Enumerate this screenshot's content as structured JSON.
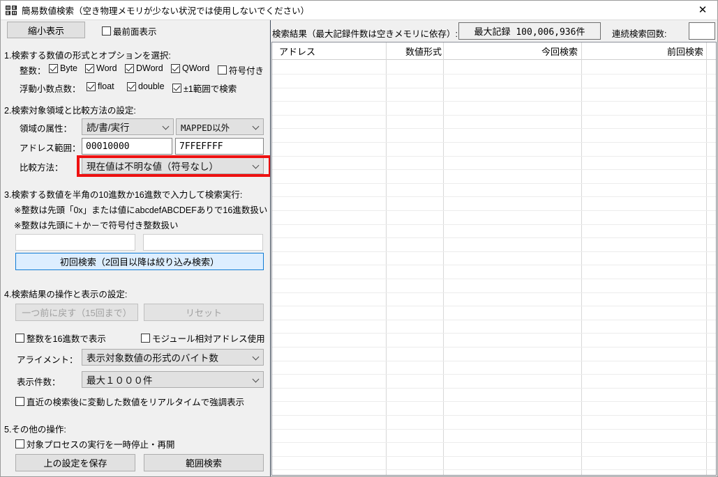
{
  "window": {
    "title": "簡易数値検索（空き物理メモリが少ない状況では使用しないでください）",
    "icon": "app-grid-icon",
    "close_label": "✕"
  },
  "toolbar": {
    "shrink_button": "縮小表示",
    "topmost_checkbox": {
      "label": "最前面表示",
      "checked": false
    }
  },
  "section1": {
    "title": "1.検索する数値の形式とオプションを選択:",
    "integer_label": "整数：",
    "integer_options": [
      {
        "label": "Byte",
        "checked": true
      },
      {
        "label": "Word",
        "checked": true
      },
      {
        "label": "DWord",
        "checked": true
      },
      {
        "label": "QWord",
        "checked": true
      },
      {
        "label": "符号付き",
        "checked": false
      }
    ],
    "float_label": "浮動小数点数：",
    "float_options": [
      {
        "label": "float",
        "checked": true
      },
      {
        "label": "double",
        "checked": true
      },
      {
        "label": "±1範囲で検索",
        "checked": true
      }
    ]
  },
  "section2": {
    "title": "2.検索対象領域と比較方法の設定:",
    "attr_label": "領域の属性：",
    "attr_select1": "読/書/実行",
    "attr_select2": "MAPPED以外",
    "range_label": "アドレス範囲：",
    "range_start": "00010000",
    "range_end": "7FFEFFFF",
    "compare_label": "比較方法：",
    "compare_select": "現在値は不明な値（符号なし）",
    "highlight_color": "#ee1111"
  },
  "section3": {
    "title": "3.検索する数値を半角の10進数か16進数で入力して検索実行:",
    "note1": "※整数は先頭「0x」または値にabcdefABCDEFありで16進数扱い",
    "note2": "※整数は先頭に＋か－で符号付き整数扱い",
    "value_input1": "",
    "value_input2": "",
    "search_button": "初回検索（2回目以降は絞り込み検索）"
  },
  "section4": {
    "title": "4.検索結果の操作と表示の設定:",
    "undo_button": {
      "label": "一つ前に戻す（15回まで）",
      "disabled": true
    },
    "reset_button": {
      "label": "リセット",
      "disabled": true
    },
    "hex_checkbox": {
      "label": "整数を16進数で表示",
      "checked": false
    },
    "module_checkbox": {
      "label": "モジュール相対アドレス使用",
      "checked": false
    },
    "alignment_label": "アライメント：",
    "alignment_select": "表示対象数値の形式のバイト数",
    "display_count_label": "表示件数：",
    "display_count_select": "最大１０００件",
    "realtime_checkbox": {
      "label": "直近の検索後に変動した数値をリアルタイムで強調表示",
      "checked": false
    }
  },
  "section5": {
    "title": "5.その他の操作:",
    "pause_checkbox": {
      "label": "対象プロセスの実行を一時停止・再開",
      "checked": false
    },
    "save_button": "上の設定を保存",
    "range_search_button": "範囲検索"
  },
  "results": {
    "label": "検索結果（最大記録件数は空きメモリに依存）:",
    "max_record": "最大記録 100,006,936件",
    "consecutive_label": "連続検索回数:",
    "consecutive_value": "",
    "columns": [
      {
        "label": "アドレス",
        "align": "left"
      },
      {
        "label": "数値形式",
        "align": "right"
      },
      {
        "label": "今回検索",
        "align": "right"
      },
      {
        "label": "前回検索",
        "align": "right"
      }
    ],
    "rows": []
  }
}
